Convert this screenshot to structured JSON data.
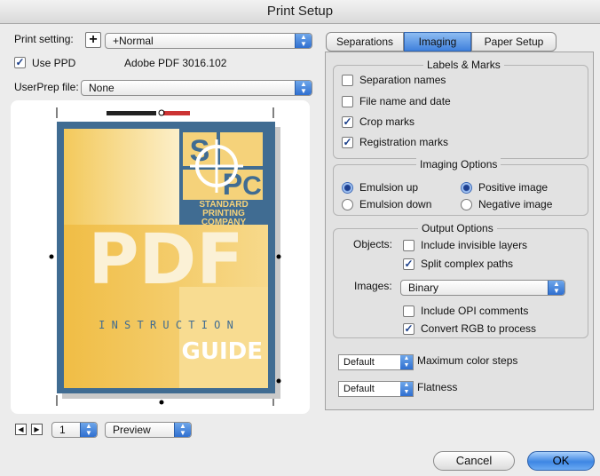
{
  "window": {
    "title": "Print Setup"
  },
  "print_setting": {
    "label": "Print setting:",
    "add_icon": "plus-icon",
    "value": "+Normal"
  },
  "use_ppd": {
    "label": "Use PPD",
    "checked": true,
    "ppd_name": "Adobe PDF 3016.102"
  },
  "userprep": {
    "label": "UserPrep file:",
    "value": "None"
  },
  "preview_doc": {
    "logo_letters": [
      "S",
      "P",
      "C"
    ],
    "company_lines": [
      "STANDARD",
      "PRINTING",
      "COMPANY"
    ],
    "big_title": "PDF",
    "instruction": "I N S T R U C T I O N",
    "guide": "GUIDE",
    "colors": {
      "frame": "#406c92",
      "yellow": "#f1c04c",
      "pale": "#f6d98d",
      "white": "#ffffff"
    }
  },
  "page_nav": {
    "prev_icon": "triangle-left-icon",
    "next_icon": "triangle-right-icon",
    "page": "1",
    "mode": "Preview"
  },
  "tabs": [
    {
      "label": "Separations",
      "selected": false
    },
    {
      "label": "Imaging",
      "selected": true
    },
    {
      "label": "Paper Setup",
      "selected": false
    }
  ],
  "labels_marks": {
    "title": "Labels & Marks",
    "items": [
      {
        "label": "Separation names",
        "checked": false
      },
      {
        "label": "File name and date",
        "checked": false
      },
      {
        "label": "Crop marks",
        "checked": true
      },
      {
        "label": "Registration marks",
        "checked": true
      }
    ]
  },
  "imaging_options": {
    "title": "Imaging Options",
    "emulsion_up": "Emulsion up",
    "emulsion_down": "Emulsion down",
    "positive": "Positive image",
    "negative": "Negative image"
  },
  "output_options": {
    "title": "Output Options",
    "objects_label": "Objects:",
    "include_invisible": "Include invisible layers",
    "split_paths": "Split complex paths",
    "images_label": "Images:",
    "images_value": "Binary",
    "include_opi": "Include OPI comments",
    "convert_rgb": "Convert RGB to process"
  },
  "max_color_steps": {
    "value": "Default",
    "label": "Maximum color steps"
  },
  "flatness": {
    "value": "Default",
    "label": "Flatness"
  },
  "buttons": {
    "cancel": "Cancel",
    "ok": "OK"
  },
  "accent": "#3f80dc"
}
